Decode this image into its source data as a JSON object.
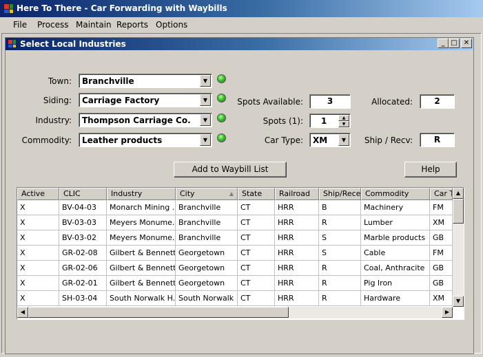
{
  "app": {
    "title": "Here To There - Car Forwarding with Waybills"
  },
  "menu": {
    "items": [
      "File",
      "Process",
      "Maintain",
      "Reports",
      "Options"
    ]
  },
  "window": {
    "title": "Select Local Industries",
    "controls": {
      "minimize": "_",
      "maximize": "□",
      "close": "✕"
    }
  },
  "form": {
    "town": {
      "label": "Town:",
      "value": "Branchville",
      "status": "green"
    },
    "siding": {
      "label": "Siding:",
      "value": "Carriage Factory",
      "status": "green"
    },
    "industry": {
      "label": "Industry:",
      "value": "Thompson Carriage Co.",
      "status": "green"
    },
    "commodity": {
      "label": "Commodity:",
      "value": "Leather products",
      "status": "green"
    },
    "spots_available": {
      "label": "Spots Available:",
      "value": "3"
    },
    "allocated": {
      "label": "Allocated:",
      "value": "2"
    },
    "spots": {
      "label": "Spots (1):",
      "value": "1"
    },
    "car_type": {
      "label": "Car Type:",
      "value": "XM"
    },
    "ship_recv": {
      "label": "Ship / Recv:",
      "value": "R"
    },
    "add_button": "Add to Waybill List",
    "help_button": "Help"
  },
  "grid": {
    "columns": [
      "Active",
      "CLIC",
      "Industry",
      "City",
      "State",
      "Railroad",
      "Ship/Rece",
      "Commodity",
      "Car T"
    ],
    "sorted_column": "City",
    "rows": [
      [
        "X",
        "BV-04-03",
        "Monarch Mining ...",
        "Branchville",
        "CT",
        "HRR",
        "B",
        "Machinery",
        "FM"
      ],
      [
        "X",
        "BV-03-03",
        "Meyers Monume...",
        "Branchville",
        "CT",
        "HRR",
        "R",
        "Lumber",
        "XM"
      ],
      [
        "X",
        "BV-03-02",
        "Meyers Monume...",
        "Branchville",
        "CT",
        "HRR",
        "S",
        "Marble products",
        "GB"
      ],
      [
        "X",
        "GR-02-08",
        "Gilbert & Bennett ...",
        "Georgetown",
        "CT",
        "HRR",
        "S",
        "Cable",
        "FM"
      ],
      [
        "X",
        "GR-02-06",
        "Gilbert & Bennett ...",
        "Georgetown",
        "CT",
        "HRR",
        "R",
        "Coal, Anthracite",
        "GB"
      ],
      [
        "X",
        "GR-02-01",
        "Gilbert & Bennett ...",
        "Georgetown",
        "CT",
        "HRR",
        "R",
        "Pig Iron",
        "GB"
      ],
      [
        "X",
        "SH-03-04",
        "South Norwalk H...",
        "South Norwalk",
        "CT",
        "HRR",
        "R",
        "Hardware",
        "XM"
      ]
    ]
  },
  "icons": {
    "app": "app-icon",
    "dropdown": "chevron-down-icon",
    "status": "status-led-icon",
    "spin_up": "spin-up-icon",
    "spin_down": "spin-down-icon",
    "sort": "sort-ascending-icon"
  },
  "colors": {
    "titlebar_start": "#0a246a",
    "titlebar_end": "#a6caf0",
    "led_green": "#3cc02a",
    "chrome": "#d4d0c8"
  }
}
